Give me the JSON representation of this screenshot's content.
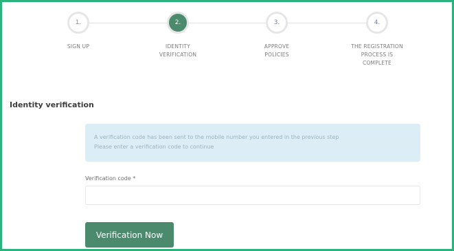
{
  "stepper": {
    "steps": [
      {
        "number": "1.",
        "label": "SIGN UP",
        "state": "done"
      },
      {
        "number": "2.",
        "label": "IDENTITY VERIFICATION",
        "state": "active"
      },
      {
        "number": "3.",
        "label": "APPROVE POLICIES",
        "state": "upcoming"
      },
      {
        "number": "4.",
        "label": "THE REGISTRATION PROCESS IS COMPLETE",
        "state": "upcoming"
      }
    ]
  },
  "section": {
    "title": "Identity verification"
  },
  "alert": {
    "line1": "A verification code has been sent to the mobile number you entered in the previous step",
    "line2": "Please enter a verification code to continue"
  },
  "form": {
    "code_label": "Verification code",
    "required_mark": "*",
    "code_value": "",
    "submit_label": "Verification Now"
  },
  "colors": {
    "accent": "#4c8a6e",
    "frame_border": "#2bb37d",
    "alert_bg": "#dcedf5"
  }
}
